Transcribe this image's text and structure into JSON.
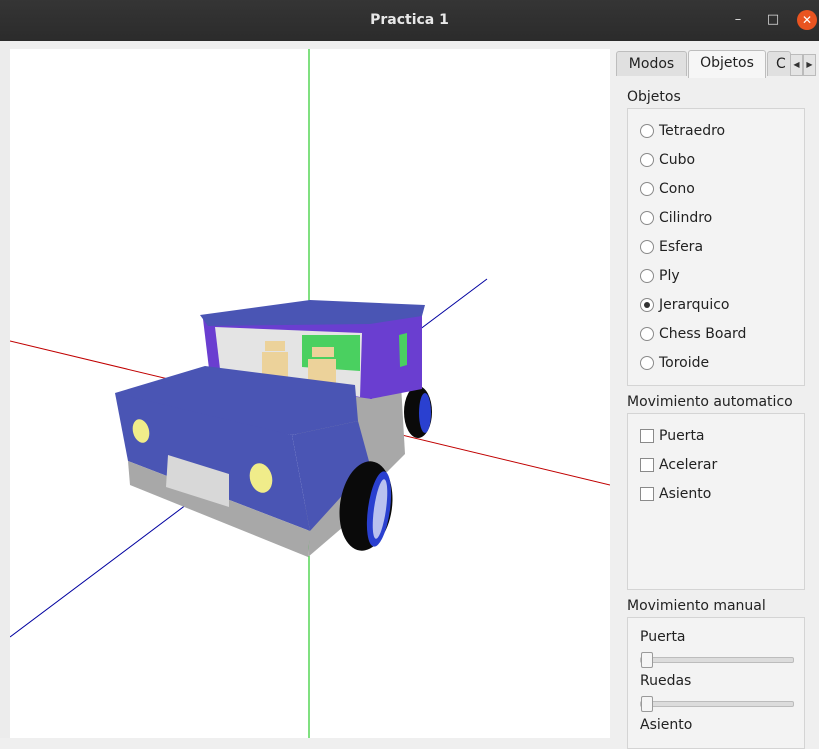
{
  "window": {
    "title": "Practica 1",
    "minimize": "–",
    "maximize": "□",
    "close": "✕"
  },
  "tabs": [
    {
      "label": "Modos"
    },
    {
      "label": "Objetos"
    },
    {
      "label": "C"
    }
  ],
  "tab_arrows": {
    "left": "◀",
    "right": "▶"
  },
  "objetos": {
    "title": "Objetos",
    "selected": "Jerarquico",
    "options": [
      {
        "label": "Tetraedro"
      },
      {
        "label": "Cubo"
      },
      {
        "label": "Cono"
      },
      {
        "label": "Cilindro"
      },
      {
        "label": "Esfera"
      },
      {
        "label": "Ply"
      },
      {
        "label": "Jerarquico"
      },
      {
        "label": "Chess Board"
      },
      {
        "label": "Toroide"
      }
    ]
  },
  "movimiento_automatico": {
    "title": "Movimiento automatico",
    "options": [
      {
        "label": "Puerta",
        "checked": false
      },
      {
        "label": "Acelerar",
        "checked": false
      },
      {
        "label": "Asiento",
        "checked": false
      }
    ]
  },
  "movimiento_manual": {
    "title": "Movimiento manual",
    "sliders": [
      {
        "label": "Puerta",
        "value": 0
      },
      {
        "label": "Ruedas",
        "value": 0
      },
      {
        "label": "Asiento",
        "value": 0
      }
    ]
  },
  "scene": {
    "axis_colors": {
      "x": "#c00000",
      "y": "#00c000",
      "z": "#0000a0"
    },
    "body_color": "#4a55b4",
    "cabin_color": "#6a3ed0",
    "window_color": "#4ad060",
    "light_color": "#f0ec8a",
    "seat_color": "#ecd29a",
    "chassis_color": "#a8a8a8",
    "tire_color": "#0a0a0a",
    "rim_color": "#2a40d0"
  }
}
